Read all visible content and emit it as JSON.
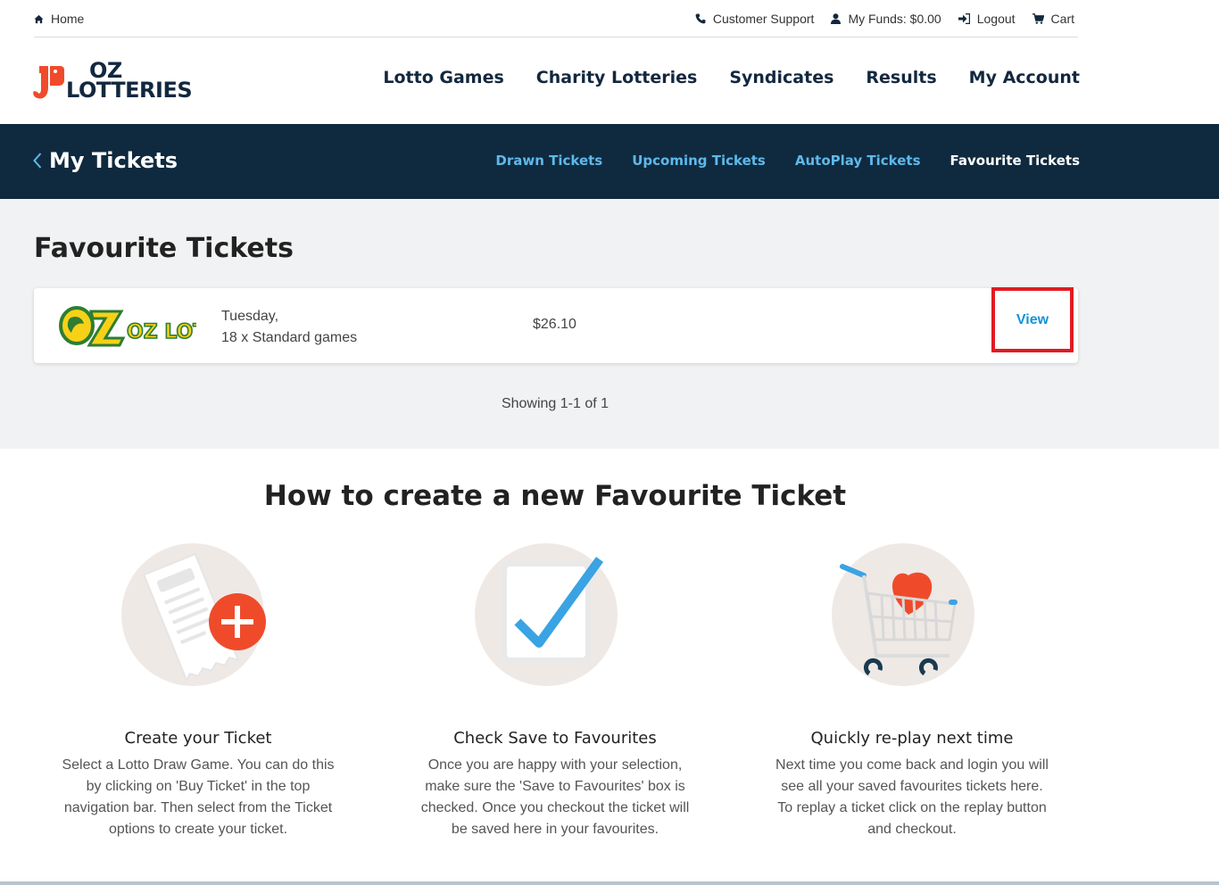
{
  "util": {
    "home": "Home",
    "support": "Customer Support",
    "funds": "My Funds: $0.00",
    "logout": "Logout",
    "cart": "Cart"
  },
  "logo": {
    "line1": "OZ",
    "line2": "LOTTERIES"
  },
  "nav": [
    "Lotto Games",
    "Charity Lotteries",
    "Syndicates",
    "Results",
    "My Account"
  ],
  "band": {
    "title": "My Tickets",
    "tabs": [
      "Drawn Tickets",
      "Upcoming Tickets",
      "AutoPlay Tickets",
      "Favourite Tickets"
    ],
    "active_tab": "Favourite Tickets"
  },
  "favourites": {
    "heading": "Favourite Tickets",
    "tickets": [
      {
        "game_logo": "OZ LOTTO",
        "day": "Tuesday,",
        "games": "18 x Standard games",
        "price": "$26.10",
        "action": "View"
      }
    ],
    "showing": "Showing 1-1 of 1"
  },
  "howto": {
    "title": "How to create a new Favourite Ticket",
    "steps": [
      {
        "title": "Create your Ticket",
        "text": "Select a Lotto Draw Game. You can do this by clicking on 'Buy Ticket' in the top navigation bar. Then select from the Ticket options to create your ticket.",
        "icon": "ticket-plus-icon"
      },
      {
        "title": "Check Save to Favourites",
        "text": "Once you are happy with your selection, make sure the 'Save to Favourites' box is checked. Once you checkout the ticket will be saved here in your favourites.",
        "icon": "checkbox-tick-icon"
      },
      {
        "title": "Quickly re-play next time",
        "text": "Next time you come back and login you will see all your saved favourites tickets here. To replay a ticket click on the replay button and checkout.",
        "icon": "cart-heart-icon"
      }
    ]
  },
  "colors": {
    "navy": "#0f2a3f",
    "accent_blue": "#5fb8ea",
    "link_blue": "#1493d6",
    "highlight_red": "#e11b22",
    "orange": "#ef4b2b"
  }
}
